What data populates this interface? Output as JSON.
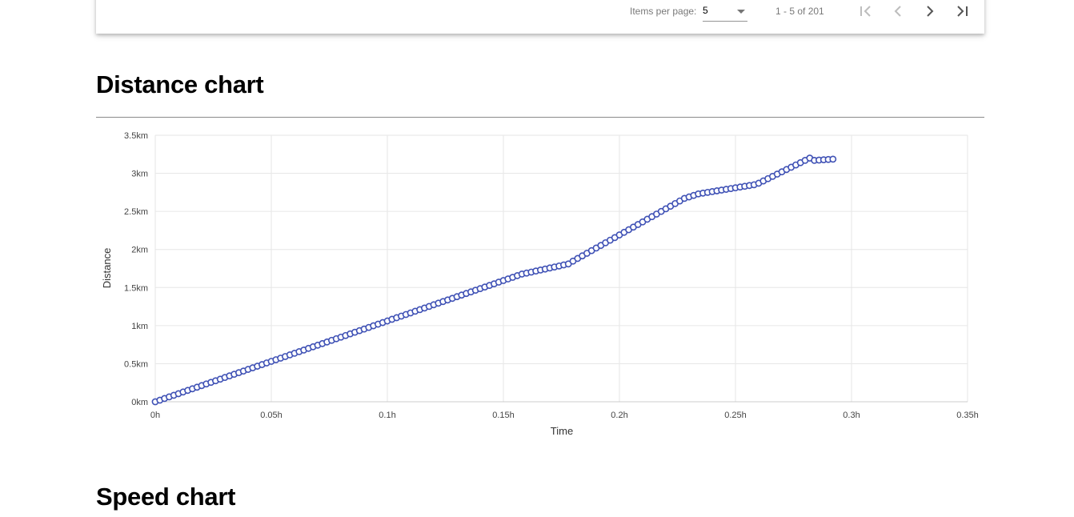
{
  "paginator": {
    "items_per_page_label": "Items per page:",
    "items_per_page_value": "5",
    "range_label": "1 - 5 of 201"
  },
  "icons": {
    "first_page": "first-page-icon",
    "previous_page": "chevron-left-icon",
    "next_page": "chevron-right-icon",
    "last_page": "last-page-icon"
  },
  "sections": {
    "distance_title": "Distance chart",
    "speed_title": "Speed chart"
  },
  "chart_data": {
    "type": "scatter",
    "title": "",
    "xlabel": "Time",
    "ylabel": "Distance",
    "xlim": [
      0,
      0.35
    ],
    "ylim": [
      0,
      3.5
    ],
    "x_ticks": [
      0,
      0.05,
      0.1,
      0.15,
      0.2,
      0.25,
      0.3,
      0.35
    ],
    "x_tick_labels": [
      "0h",
      "0.05h",
      "0.1h",
      "0.15h",
      "0.2h",
      "0.25h",
      "0.3h",
      "0.35h"
    ],
    "y_ticks": [
      0,
      0.5,
      1,
      1.5,
      2,
      2.5,
      3,
      3.5
    ],
    "y_tick_labels": [
      "0km",
      "0.5km",
      "1km",
      "1.5km",
      "2km",
      "2.5km",
      "3km",
      "3.5km"
    ],
    "grid": true,
    "marker_color": "#3f51b5",
    "series": [
      {
        "x_unit": "h",
        "y_unit": "km",
        "x": [
          0,
          0.002,
          0.004,
          0.006,
          0.008,
          0.01,
          0.012,
          0.014,
          0.016,
          0.018,
          0.02,
          0.022,
          0.024,
          0.026,
          0.028,
          0.03,
          0.032,
          0.034,
          0.036,
          0.038,
          0.04,
          0.042,
          0.044,
          0.046,
          0.048,
          0.05,
          0.052,
          0.054,
          0.056,
          0.058,
          0.06,
          0.062,
          0.064,
          0.066,
          0.068,
          0.07,
          0.072,
          0.074,
          0.076,
          0.078,
          0.08,
          0.082,
          0.084,
          0.086,
          0.088,
          0.09,
          0.092,
          0.094,
          0.096,
          0.098,
          0.1,
          0.102,
          0.104,
          0.106,
          0.108,
          0.11,
          0.112,
          0.114,
          0.116,
          0.118,
          0.12,
          0.122,
          0.124,
          0.126,
          0.128,
          0.13,
          0.132,
          0.134,
          0.136,
          0.138,
          0.14,
          0.142,
          0.144,
          0.146,
          0.148,
          0.15,
          0.152,
          0.154,
          0.156,
          0.158,
          0.16,
          0.162,
          0.164,
          0.166,
          0.168,
          0.17,
          0.172,
          0.174,
          0.176,
          0.178,
          0.18,
          0.182,
          0.184,
          0.186,
          0.188,
          0.19,
          0.192,
          0.194,
          0.196,
          0.198,
          0.2,
          0.202,
          0.204,
          0.206,
          0.208,
          0.21,
          0.212,
          0.214,
          0.216,
          0.218,
          0.22,
          0.222,
          0.224,
          0.226,
          0.228,
          0.23,
          0.232,
          0.234,
          0.236,
          0.238,
          0.24,
          0.242,
          0.244,
          0.246,
          0.248,
          0.25,
          0.252,
          0.254,
          0.256,
          0.258,
          0.26,
          0.262,
          0.264,
          0.266,
          0.268,
          0.27,
          0.272,
          0.274,
          0.276,
          0.278,
          0.28,
          0.282,
          0.284,
          0.286,
          0.288,
          0.29,
          0.292
        ],
        "y": [
          0.0,
          0.021,
          0.043,
          0.064,
          0.085,
          0.106,
          0.128,
          0.149,
          0.17,
          0.191,
          0.212,
          0.234,
          0.255,
          0.276,
          0.297,
          0.319,
          0.34,
          0.361,
          0.382,
          0.403,
          0.425,
          0.446,
          0.467,
          0.488,
          0.51,
          0.531,
          0.552,
          0.573,
          0.594,
          0.616,
          0.637,
          0.658,
          0.679,
          0.701,
          0.722,
          0.743,
          0.764,
          0.785,
          0.807,
          0.828,
          0.849,
          0.87,
          0.892,
          0.913,
          0.934,
          0.955,
          0.976,
          0.998,
          1.019,
          1.04,
          1.061,
          1.083,
          1.104,
          1.125,
          1.146,
          1.167,
          1.189,
          1.21,
          1.231,
          1.252,
          1.274,
          1.295,
          1.316,
          1.337,
          1.358,
          1.38,
          1.401,
          1.422,
          1.443,
          1.465,
          1.486,
          1.507,
          1.528,
          1.549,
          1.571,
          1.592,
          1.613,
          1.634,
          1.656,
          1.677,
          1.69,
          1.703,
          1.717,
          1.73,
          1.743,
          1.757,
          1.77,
          1.783,
          1.797,
          1.81,
          1.847,
          1.882,
          1.916,
          1.95,
          1.985,
          2.019,
          2.053,
          2.088,
          2.122,
          2.156,
          2.191,
          2.225,
          2.259,
          2.294,
          2.328,
          2.362,
          2.397,
          2.431,
          2.465,
          2.5,
          2.534,
          2.568,
          2.603,
          2.637,
          2.671,
          2.69,
          2.71,
          2.73,
          2.74,
          2.75,
          2.76,
          2.77,
          2.78,
          2.79,
          2.8,
          2.81,
          2.82,
          2.83,
          2.84,
          2.85,
          2.87,
          2.9,
          2.93,
          2.96,
          2.99,
          3.02,
          3.05,
          3.08,
          3.11,
          3.14,
          3.17,
          3.2,
          3.17,
          3.174,
          3.178,
          3.182,
          3.186
        ]
      }
    ]
  }
}
